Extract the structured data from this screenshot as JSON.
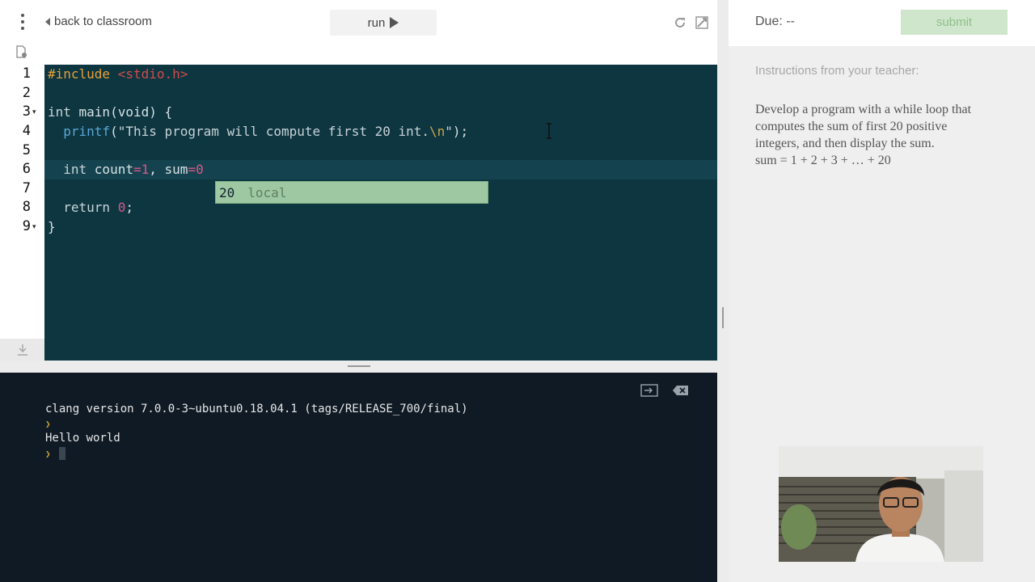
{
  "toolbar": {
    "back_label": "back to classroom",
    "run_label": "run"
  },
  "editor": {
    "line_numbers": [
      "1",
      "2",
      "3",
      "4",
      "5",
      "6",
      "7",
      "8",
      "9"
    ],
    "fold_markers": [
      "▾",
      "▾"
    ],
    "lines": {
      "l1_directive": "#include",
      "l1_header": "<stdio.h>",
      "l3_type": "int ",
      "l3_rest": "main(void) {",
      "l4_indent": "  ",
      "l4_fn": "printf",
      "l4_open": "(",
      "l4_str_a": "\"This program will compute first 20 int.",
      "l4_esc": "\\n",
      "l4_str_b": "\"",
      "l4_close": ");",
      "l6_indent": "  ",
      "l6_type": "int ",
      "l6_var1": "count",
      "l6_eq1": "=",
      "l6_num1": "1",
      "l6_sep": ", sum",
      "l6_eq2": "=",
      "l6_num2": "0",
      "l8_indent": "  ",
      "l8_kw": "return ",
      "l8_num": "0",
      "l8_semi": ";",
      "l9_brace": "}"
    },
    "autocomplete": {
      "value": "20",
      "kind": "local"
    }
  },
  "console": {
    "lines": [
      "clang version 7.0.0-3~ubuntu0.18.04.1 (tags/RELEASE_700/final)",
      "Hello world"
    ],
    "prompt_glyph": "❯"
  },
  "assignment": {
    "due": "Due: --",
    "submit_label": "submit",
    "instructions_heading": "Instructions from your teacher:",
    "instructions": [
      "Develop a program with a while loop that",
      "computes the sum of first 20 positive",
      "integers, and then display the sum.",
      "sum = 1 + 2 + 3 + … + 20"
    ]
  },
  "colors": {
    "editor_bg": "#0d3641",
    "console_bg": "#0f1a24",
    "submit_bg": "#cfe6cc",
    "autocomplete_bg": "#9ec8a2"
  }
}
